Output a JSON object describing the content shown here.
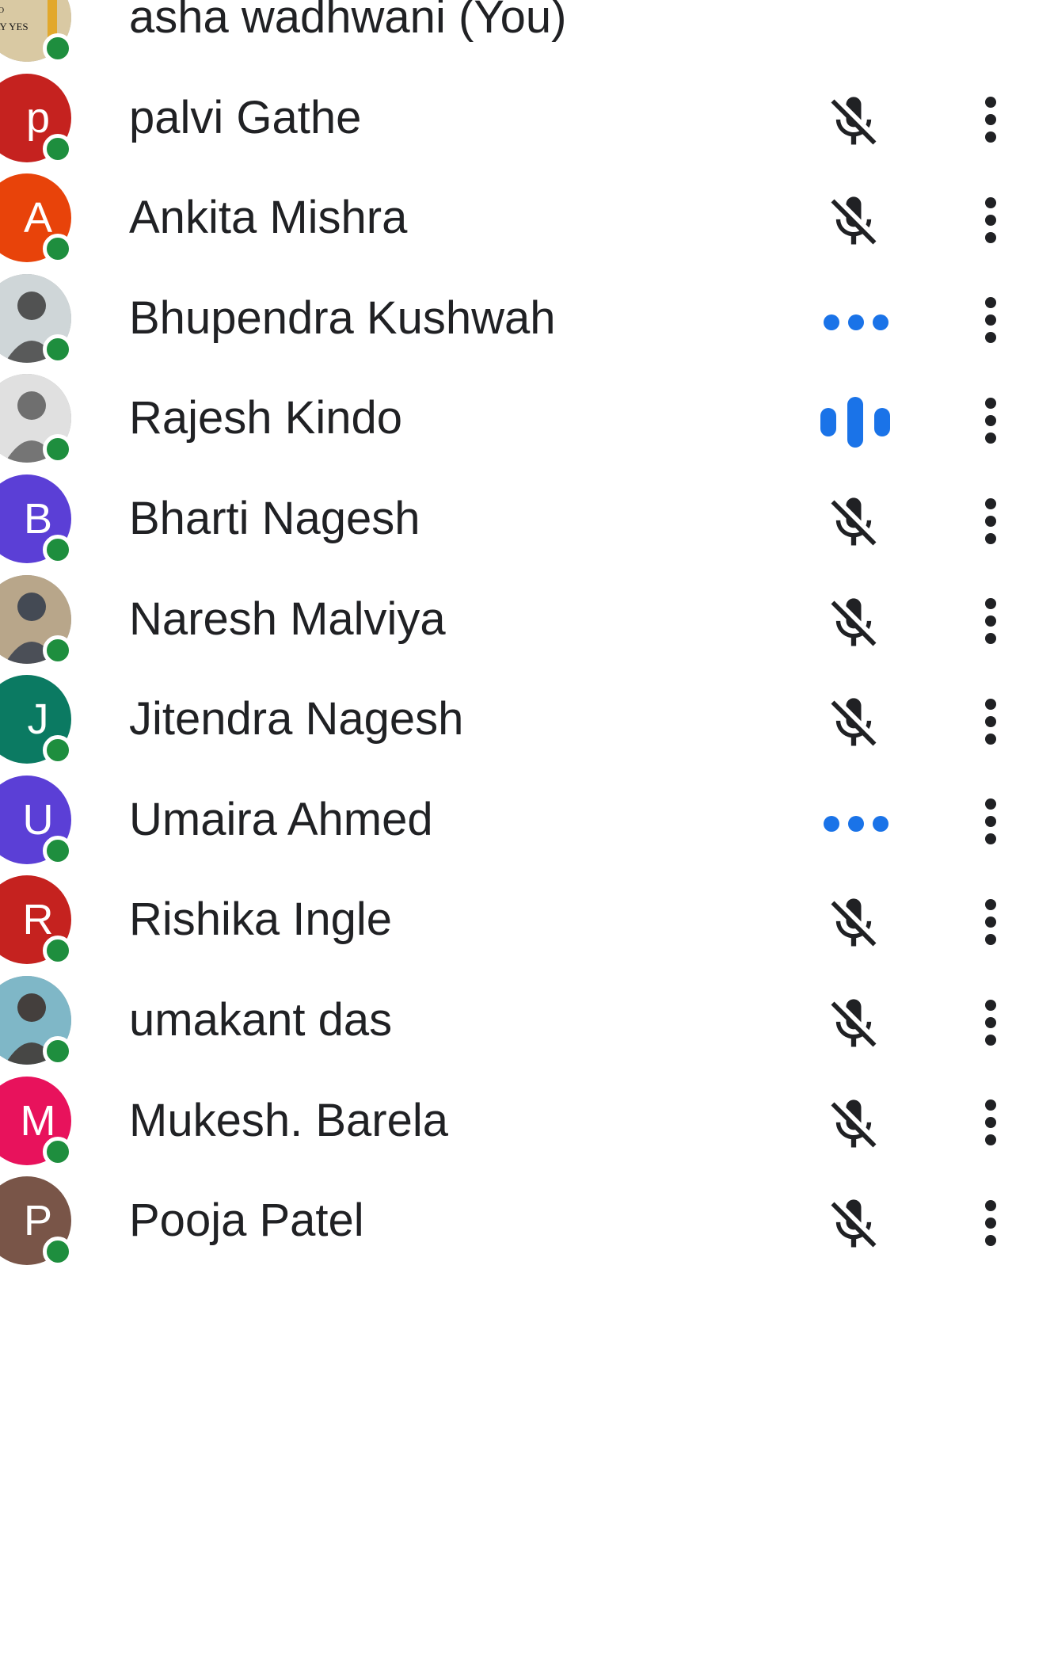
{
  "participants": [
    {
      "name": "asha wadhwani (You)",
      "avatar": {
        "kind": "photo",
        "photo_text": [
          "SAY NO",
          "TO",
          "SAY YES"
        ]
      },
      "audio": "none"
    },
    {
      "name": "palvi Gathe",
      "avatar": {
        "kind": "letter",
        "letter": "p",
        "color": "#c5221f"
      },
      "audio": "muted"
    },
    {
      "name": "Ankita Mishra",
      "avatar": {
        "kind": "letter",
        "letter": "A",
        "color": "#e8430a"
      },
      "audio": "muted"
    },
    {
      "name": "Bhupendra Kushwah",
      "avatar": {
        "kind": "photo"
      },
      "audio": "idle"
    },
    {
      "name": "Rajesh Kindo",
      "avatar": {
        "kind": "photo"
      },
      "audio": "speaking"
    },
    {
      "name": "Bharti Nagesh",
      "avatar": {
        "kind": "letter",
        "letter": "B",
        "color": "#5b3fd6"
      },
      "audio": "muted"
    },
    {
      "name": "Naresh Malviya",
      "avatar": {
        "kind": "photo"
      },
      "audio": "muted"
    },
    {
      "name": "Jitendra Nagesh",
      "avatar": {
        "kind": "letter",
        "letter": "J",
        "color": "#0b7a62"
      },
      "audio": "muted"
    },
    {
      "name": "Umaira Ahmed",
      "avatar": {
        "kind": "letter",
        "letter": "U",
        "color": "#5b3fd6"
      },
      "audio": "idle"
    },
    {
      "name": "Rishika Ingle",
      "avatar": {
        "kind": "letter",
        "letter": "R",
        "color": "#c5221f"
      },
      "audio": "muted"
    },
    {
      "name": "umakant das",
      "avatar": {
        "kind": "photo"
      },
      "audio": "muted"
    },
    {
      "name": "Mukesh. Barela",
      "avatar": {
        "kind": "letter",
        "letter": "M",
        "color": "#e8125c"
      },
      "audio": "muted"
    },
    {
      "name": "Pooja Patel",
      "avatar": {
        "kind": "letter",
        "letter": "P",
        "color": "#795548"
      },
      "audio": "muted"
    }
  ],
  "colors": {
    "online_status": "#1e8e3e",
    "audio_activity": "#1a73e8",
    "text": "#202124",
    "icon": "#202124"
  },
  "icons": {
    "muted": "mic-off-icon",
    "idle": "audio-idle-dots-icon",
    "speaking": "audio-speaking-bars-icon",
    "more": "more-vert-icon"
  }
}
